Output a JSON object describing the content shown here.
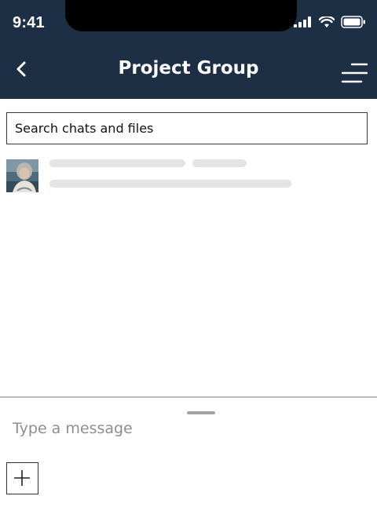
{
  "status_bar": {
    "time": "9:41",
    "icons": [
      "signal-icon",
      "wifi-icon",
      "battery-icon"
    ]
  },
  "header": {
    "title": "Project Group",
    "back_icon": "chevron-left-icon",
    "menu_icon": "menu-icon",
    "background": "#1c2f44"
  },
  "search": {
    "placeholder": "Search chats and files"
  },
  "results": [
    {
      "avatar_icon": "avatar",
      "loading": true
    }
  ],
  "composer": {
    "placeholder": "Type a message",
    "add_icon": "plus-icon"
  }
}
